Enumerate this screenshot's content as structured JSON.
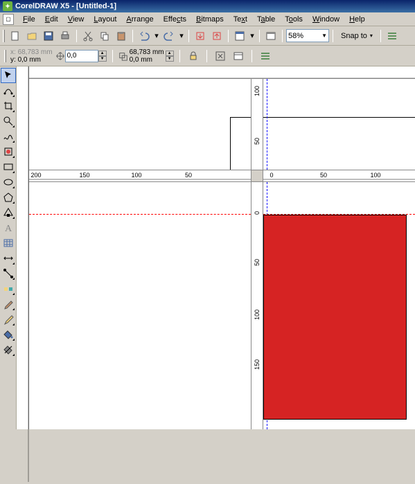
{
  "titlebar": {
    "app": "CorelDRAW X5",
    "doc": "[Untitled-1]"
  },
  "menus": [
    "File",
    "Edit",
    "View",
    "Layout",
    "Arrange",
    "Effects",
    "Bitmaps",
    "Text",
    "Table",
    "Tools",
    "Window",
    "Help"
  ],
  "std_toolbar": {
    "zoom": "58%",
    "snap_label": "Snap to"
  },
  "propbar": {
    "x_label": "x:",
    "x_value": "68,783 mm",
    "y_label": "y:",
    "y_value": "0,0 mm",
    "nudge": "0,0",
    "w_value": "68,783 mm",
    "h_value": "0,0 mm"
  },
  "ruler_h_top": [],
  "ruler_h_bot": [
    "200",
    "150",
    "100",
    "50",
    "0",
    "50",
    "100"
  ],
  "ruler_v_left": [],
  "ruler_v_right": [
    "100",
    "50",
    "0",
    "50",
    "100",
    "150"
  ],
  "shapes": {
    "rect1": {
      "fill": "#d62323"
    }
  }
}
